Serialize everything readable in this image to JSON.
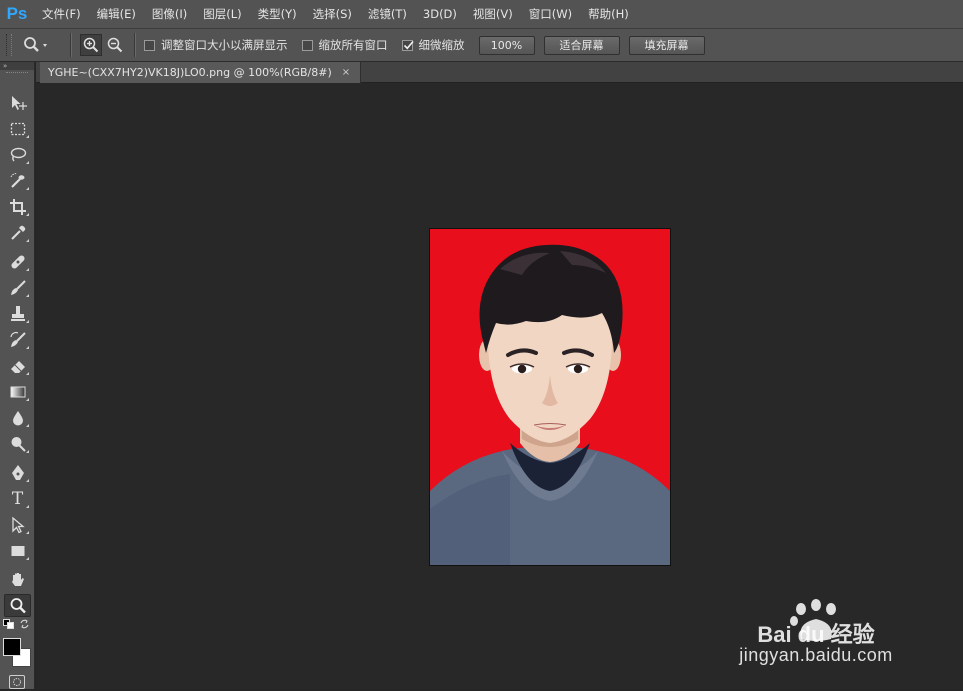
{
  "app": {
    "logo": "Ps"
  },
  "menu": [
    "文件(F)",
    "编辑(E)",
    "图像(I)",
    "图层(L)",
    "类型(Y)",
    "选择(S)",
    "滤镜(T)",
    "3D(D)",
    "视图(V)",
    "窗口(W)",
    "帮助(H)"
  ],
  "options": {
    "resize_windows_label": "调整窗口大小以满屏显示",
    "resize_windows_checked": false,
    "zoom_all_label": "缩放所有窗口",
    "zoom_all_checked": false,
    "scrubby_zoom_label": "细微缩放",
    "scrubby_zoom_checked": true,
    "btn_100": "100%",
    "btn_fit": "适合屏幕",
    "btn_fill": "填充屏幕"
  },
  "document": {
    "tab_title": "YGHE~(CXX7HY2)VK18J)LO0.png @ 100%(RGB/8#)",
    "close_glyph": "×",
    "background_color": "#e80e1c"
  },
  "toolbox": {
    "collapse_glyph": "»",
    "tools": [
      "move-tool",
      "marquee-tool",
      "lasso-tool",
      "quick-select-tool",
      "crop-tool",
      "eyedropper-tool",
      "healing-brush-tool",
      "brush-tool",
      "clone-stamp-tool",
      "history-brush-tool",
      "eraser-tool",
      "gradient-tool",
      "blur-tool",
      "dodge-tool",
      "pen-tool",
      "type-tool",
      "path-select-tool",
      "rectangle-tool",
      "hand-tool",
      "zoom-tool"
    ],
    "active_tool": "zoom-tool",
    "type_glyph": "T",
    "foreground_color": "#000000",
    "background_color": "#ffffff"
  },
  "watermark": {
    "brand": "Bai du 经验",
    "url": "jingyan.baidu.com"
  }
}
